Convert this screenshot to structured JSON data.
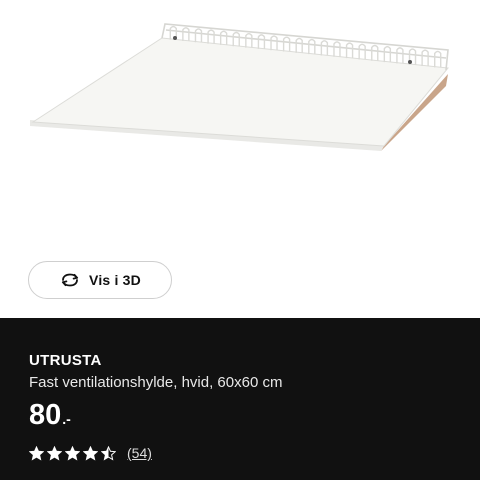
{
  "view3d": {
    "label": "Vis i 3D",
    "icon": "rotate-3d-icon"
  },
  "product": {
    "name": "UTRUSTA",
    "description": "Fast ventilationshylde, hvid, 60x60 cm",
    "price_integer": "80",
    "price_decimal": ".-",
    "rating_value": 4.5,
    "rating_max": 5,
    "review_count": "(54)"
  },
  "colors": {
    "panel_background": "#111111",
    "shelf_white": "#f6f6f3",
    "edge_wood": "#c9a58a"
  }
}
